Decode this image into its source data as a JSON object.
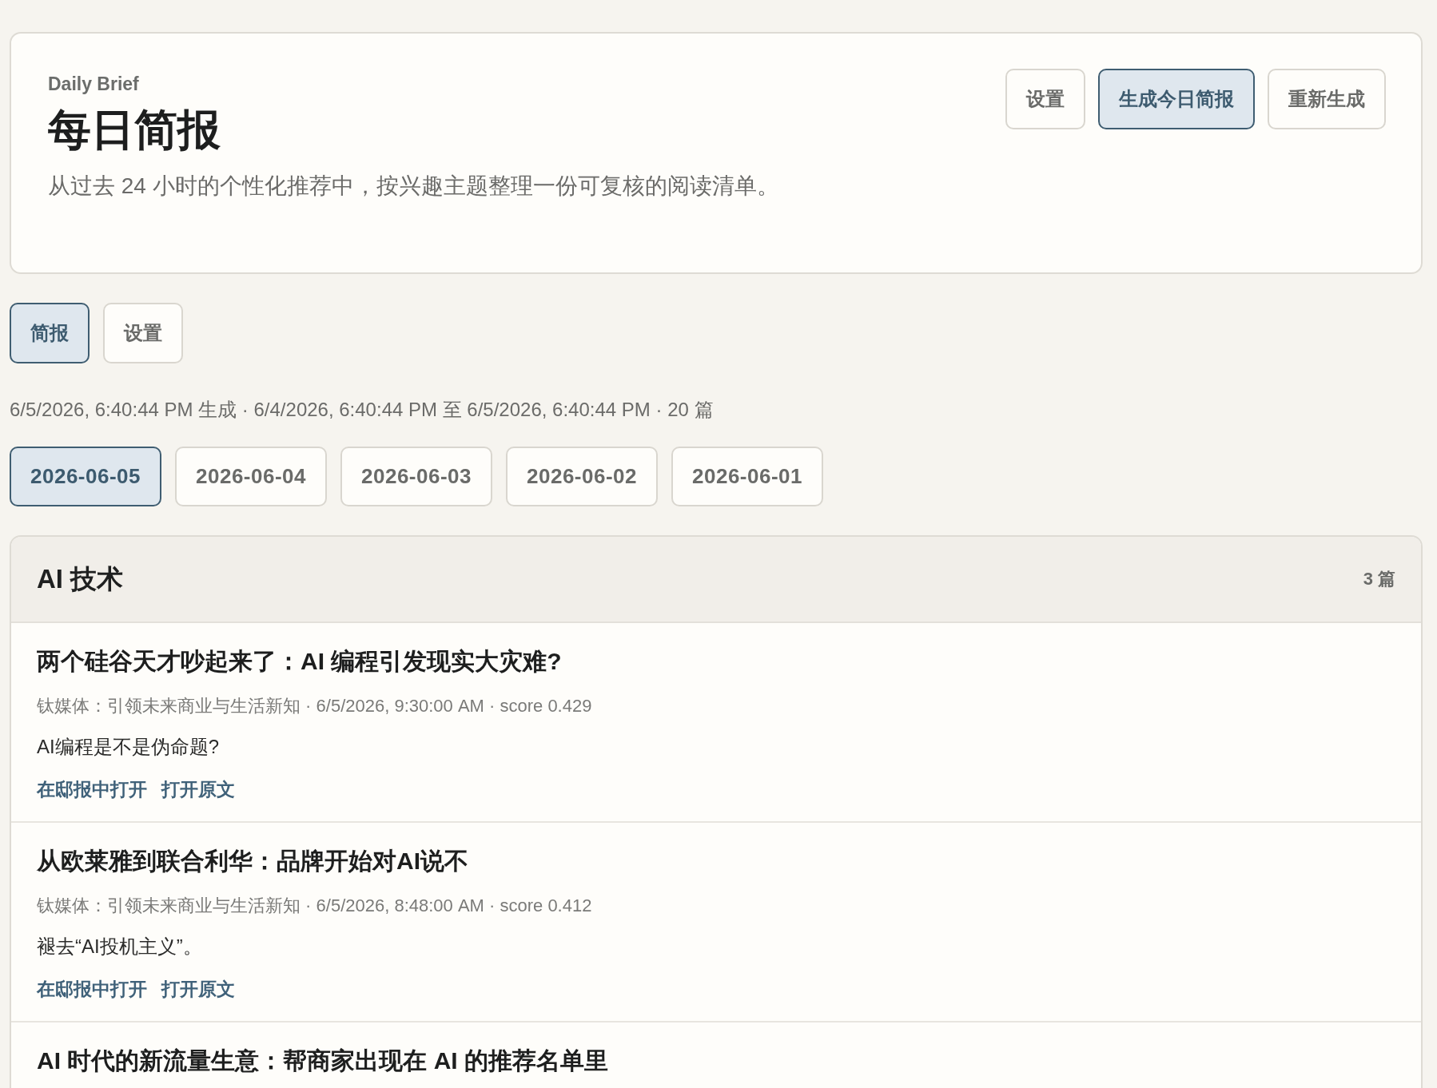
{
  "header": {
    "eyebrow": "Daily Brief",
    "title": "每日简报",
    "subtitle": "从过去 24 小时的个性化推荐中，按兴趣主题整理一份可复核的阅读清单。",
    "buttons": [
      {
        "label": "设置",
        "selected": false
      },
      {
        "label": "生成今日简报",
        "selected": true
      },
      {
        "label": "重新生成",
        "selected": false
      }
    ]
  },
  "tabs": [
    {
      "label": "简报",
      "selected": true
    },
    {
      "label": "设置",
      "selected": false
    }
  ],
  "meta": "6/5/2026, 6:40:44 PM 生成 · 6/4/2026, 6:40:44 PM 至 6/5/2026, 6:40:44 PM · 20 篇",
  "dates": [
    {
      "label": "2026-06-05",
      "selected": true
    },
    {
      "label": "2026-06-04",
      "selected": false
    },
    {
      "label": "2026-06-03",
      "selected": false
    },
    {
      "label": "2026-06-02",
      "selected": false
    },
    {
      "label": "2026-06-01",
      "selected": false
    }
  ],
  "section": {
    "title": "AI 技术",
    "count": "3 篇",
    "articles": [
      {
        "title": "两个硅谷天才吵起来了：AI 编程引发现实大灾难?",
        "meta": "钛媒体：引领未来商业与生活新知 · 6/5/2026, 9:30:00 AM · score 0.429",
        "summary": "AI编程是不是伪命题?",
        "links": [
          "在邸报中打开",
          "打开原文"
        ]
      },
      {
        "title": "从欧莱雅到联合利华：品牌开始对AI说不",
        "meta": "钛媒体：引领未来商业与生活新知 · 6/5/2026, 8:48:00 AM · score 0.412",
        "summary": "褪去“AI投机主义”。",
        "links": [
          "在邸报中打开",
          "打开原文"
        ]
      },
      {
        "title": "AI 时代的新流量生意：帮商家出现在 AI 的推荐名单里"
      }
    ]
  }
}
